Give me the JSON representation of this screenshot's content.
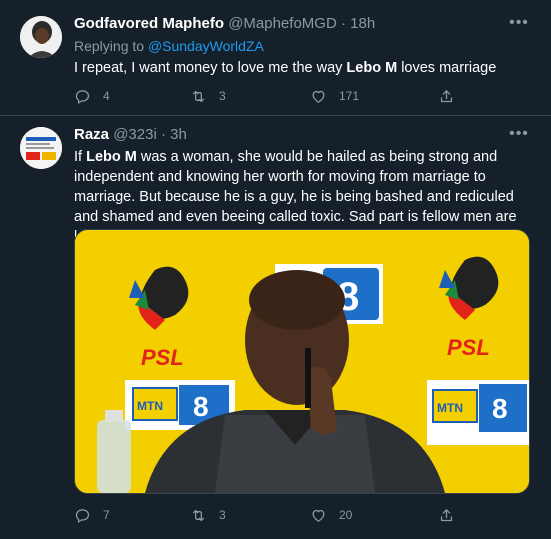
{
  "tweets": [
    {
      "name": "Godfavored Maphefo",
      "handle": "@MaphefoMGD",
      "dot": "·",
      "time": "18h",
      "reply_prefix": "Replying to",
      "reply_to": "@SundayWorldZA",
      "text_plain_1": "I repeat, I want money to love me the way ",
      "text_bold_1": "Lebo M",
      "text_plain_2": " loves marriage",
      "replies": "4",
      "retweets": "3",
      "likes": "171"
    },
    {
      "name": "Raza",
      "handle": "@323i",
      "dot": "·",
      "time": "3h",
      "text_plain_1": "If ",
      "text_bold_1": "Lebo M",
      "text_plain_2": " was a woman, she would be hailed as being strong and independent and knowing her worth for moving from marriage to marriage. But because he is a guy, he is being bashed and rediculed and shamed and even beeing called toxic. Sad part is fellow men are leading th assault",
      "replies": "7",
      "retweets": "3",
      "likes": "20"
    }
  ],
  "colors": {
    "background": "#15202b",
    "muted": "#8b98a5",
    "link": "#1d9bf0",
    "divider": "#38444d"
  },
  "icons": {
    "more": "more-icon",
    "reply": "reply-icon",
    "retweet": "retweet-icon",
    "like": "like-icon",
    "share": "share-icon"
  }
}
